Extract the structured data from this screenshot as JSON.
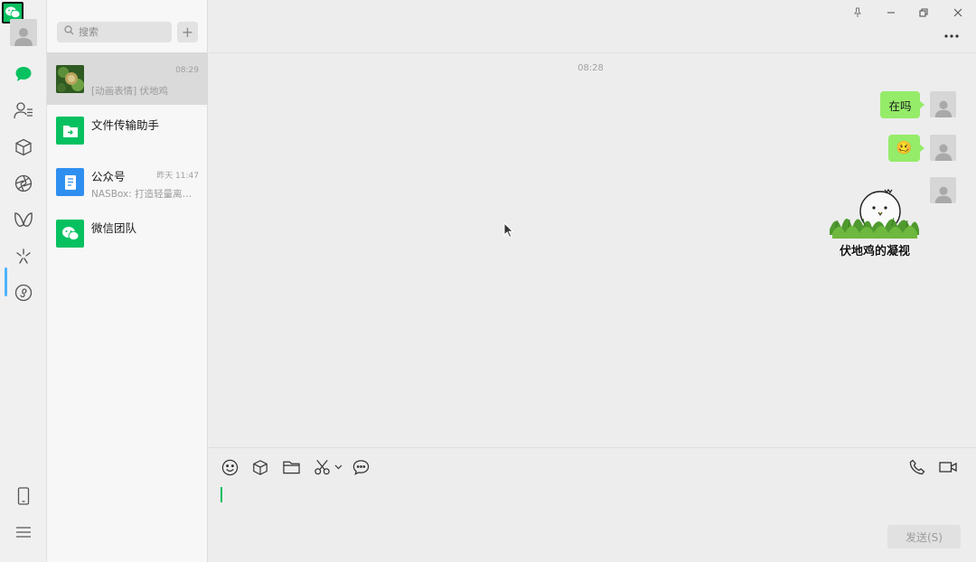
{
  "colors": {
    "accent": "#07c160",
    "bubble": "#95ec69",
    "rail_indicator": "#4fb3ff"
  },
  "rail": {
    "items": [
      {
        "icon": "chat-bubble-icon"
      },
      {
        "icon": "contacts-icon"
      },
      {
        "icon": "favorites-cube-icon"
      },
      {
        "icon": "moments-aperture-icon"
      },
      {
        "icon": "channels-butterfly-icon"
      },
      {
        "icon": "top-stories-icon"
      },
      {
        "icon": "mini-programs-icon"
      }
    ],
    "bottom": [
      {
        "icon": "phone-device-icon"
      },
      {
        "icon": "menu-icon"
      }
    ]
  },
  "search": {
    "placeholder": "搜索",
    "add_label": "+"
  },
  "chats": [
    {
      "name": "",
      "time": "08:29",
      "preview": "[动画表情] 伏地鸡",
      "active": true
    },
    {
      "name": "文件传输助手",
      "time": "",
      "preview": ""
    },
    {
      "name": "公众号",
      "time": "昨天 11:47",
      "preview": "NASBox: 打造轻量离线..."
    },
    {
      "name": "微信团队",
      "time": "",
      "preview": ""
    }
  ],
  "conversation": {
    "timestamp": "08:28",
    "messages": [
      {
        "type": "text",
        "text": "在吗"
      },
      {
        "type": "emoji",
        "text": "🥴"
      },
      {
        "type": "sticker",
        "caption": "伏地鸡的凝视"
      }
    ]
  },
  "composer": {
    "tools": [
      "emoji-icon",
      "favorites-icon",
      "folder-icon",
      "screenshot-scissors-icon",
      "chat-history-icon"
    ],
    "calls": [
      "voice-call-icon",
      "video-call-icon"
    ],
    "send_label": "发送(S)"
  }
}
